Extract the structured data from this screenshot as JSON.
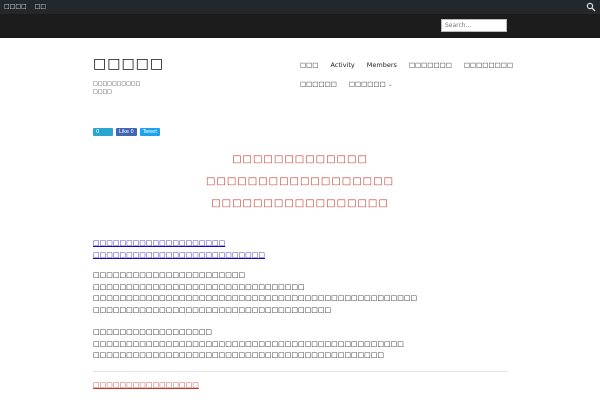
{
  "adminbar": {
    "items": [
      "□□□□",
      "□□"
    ],
    "search_icon": "search-icon"
  },
  "search": {
    "placeholder": "Search..."
  },
  "site": {
    "title": "□□□□□",
    "description": "□□□□□□□□□□□□□□"
  },
  "nav": {
    "row1": [
      "□□□",
      "Activity",
      "Members",
      "□□□□□□□",
      "□□□□□□□□"
    ],
    "row2": [
      "□□□□□□",
      "□□□□□□"
    ],
    "dropdown_caret": "chevron-down-icon"
  },
  "share": {
    "count": "0",
    "like": "Like 0",
    "tweet": "Tweet"
  },
  "headlines": [
    "□□□□□□□□□□□□□",
    "□□□□□□□□□□□□□□□□□□",
    "□□□□□□□□□□□□□□□□□"
  ],
  "colors": {
    "headline": "#c0392b",
    "link": "#1a0dab",
    "adminbar": "#23282d"
  },
  "body": {
    "blue_lines": [
      "□□□□□□□□□□□□□□□□□□□□",
      "□□□□□□□□□□□□□□□□□□□□□□□□□□"
    ],
    "para1": [
      "□□□□□□□□□□□□□□□□□□□□□□□",
      "□□□□□□□□□□□□□□□□□□□□□□□□□□□□□□□□",
      "□□□□□□□□□□□□□□□□□□□□□□□□□□□□□□□□□□□□□□□□□□□□□□□□□",
      "□□□□□□□□□□□□□□□□□□□□□□□□□□□□□□□□□□□□"
    ],
    "para2": [
      "□□□□□□□□□□□□□□□□□□",
      "□□□□□□□□□□□□□□□□□□□□□□□□□□□□□□□□□□□□□□□□□□□□□□□",
      "□□□□□□□□□□□□□□□□□□□□□□□□□□□□□□□□□□□□□□□□□□□□"
    ],
    "red_link": "□□□□□□□□□□□□□□□□"
  }
}
